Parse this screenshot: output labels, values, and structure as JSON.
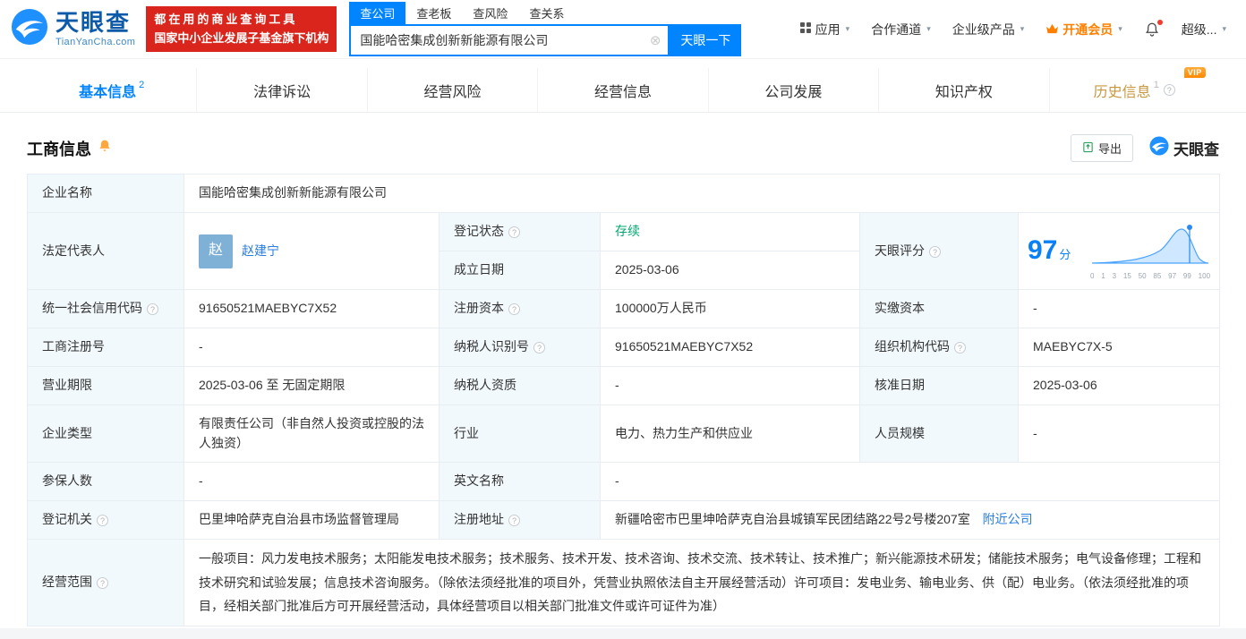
{
  "colors": {
    "brand_blue": "#0084ff",
    "slogan_red": "#d9251c",
    "status_green": "#00a870",
    "vip_orange": "#ff8000"
  },
  "brand": {
    "name": "天眼查",
    "domain": "TianYanCha.com"
  },
  "header": {
    "slogan_line1": "都在用的商业查询工具",
    "slogan_line2": "国家中小企业发展子基金旗下机构",
    "search_tabs": [
      {
        "label": "查公司"
      },
      {
        "label": "查老板"
      },
      {
        "label": "查风险"
      },
      {
        "label": "查关系"
      }
    ],
    "search_value": "国能哈密集成创新新能源有限公司",
    "search_button": "天眼一下",
    "menu_app": "应用",
    "menu_coop": "合作通道",
    "menu_enterprise": "企业级产品",
    "menu_vip": "开通会员",
    "menu_user": "超级..."
  },
  "nav_tabs": [
    {
      "label": "基本信息",
      "badge": "2"
    },
    {
      "label": "法律诉讼",
      "badge": ""
    },
    {
      "label": "经营风险",
      "badge": ""
    },
    {
      "label": "经营信息",
      "badge": ""
    },
    {
      "label": "公司发展",
      "badge": ""
    },
    {
      "label": "知识产权",
      "badge": ""
    },
    {
      "label": "历史信息",
      "badge": "1",
      "vip": "VIP"
    }
  ],
  "section": {
    "title": "工商信息",
    "export": "导出",
    "logo_text": "天眼查"
  },
  "info": {
    "name_label": "企业名称",
    "name": "国能哈密集成创新新能源有限公司",
    "legal_label": "法定代表人",
    "legal_avatar": "赵",
    "legal_name": "赵建宁",
    "status_label": "登记状态",
    "status": "存续",
    "established_label": "成立日期",
    "established": "2025-03-06",
    "score_label": "天眼评分",
    "score": "97",
    "score_unit": "分",
    "score_axis": [
      "0",
      "1",
      "3",
      "15",
      "50",
      "85",
      "97",
      "99",
      "100"
    ],
    "credit_label": "统一社会信用代码",
    "credit": "91650521MAEBYC7X52",
    "capital_label": "注册资本",
    "capital": "100000万人民币",
    "paid_label": "实缴资本",
    "paid": "-",
    "regno_label": "工商注册号",
    "regno": "-",
    "tax_label": "纳税人识别号",
    "tax": "91650521MAEBYC7X52",
    "orgcode_label": "组织机构代码",
    "orgcode": "MAEBYC7X-5",
    "term_label": "营业期限",
    "term": "2025-03-06 至 无固定期限",
    "taxquality_label": "纳税人资质",
    "taxquality": "-",
    "approved_label": "核准日期",
    "approved": "2025-03-06",
    "type_label": "企业类型",
    "type": "有限责任公司（非自然人投资或控股的法人独资）",
    "industry_label": "行业",
    "industry": "电力、热力生产和供应业",
    "staff_label": "人员规模",
    "staff": "-",
    "insured_label": "参保人数",
    "insured": "-",
    "en_label": "英文名称",
    "en": "-",
    "registry_label": "登记机关",
    "registry": "巴里坤哈萨克自治县市场监督管理局",
    "address_label": "注册地址",
    "address": "新疆哈密市巴里坤哈萨克自治县城镇军民团结路22号2号楼207室",
    "nearby": "附近公司",
    "scope_label": "经营范围",
    "scope": "一般项目：风力发电技术服务；太阳能发电技术服务；技术服务、技术开发、技术咨询、技术交流、技术转让、技术推广；新兴能源技术研发；储能技术服务；电气设备修理；工程和技术研究和试验发展；信息技术咨询服务。（除依法须经批准的项目外，凭营业执照依法自主开展经营活动）许可项目：发电业务、输电业务、供（配）电业务。（依法须经批准的项目，经相关部门批准后方可开展经营活动，具体经营项目以相关部门批准文件或许可证件为准）"
  }
}
